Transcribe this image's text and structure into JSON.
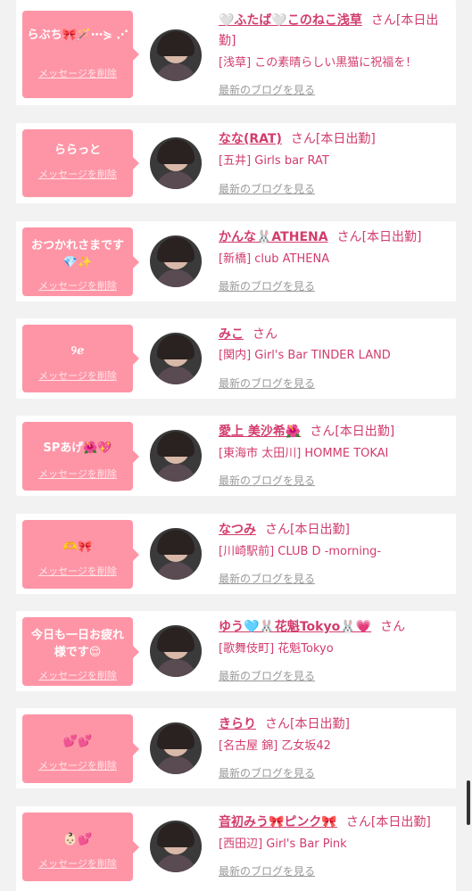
{
  "delete_label": "メッセージを削除",
  "blog_label": "最新のブログを見る",
  "san": "さん",
  "colors": {
    "bubble": "#fe95a6",
    "accent": "#d23c6c",
    "link_gray": "#9a9a9a",
    "background": "#f2f2f2"
  },
  "entries": [
    {
      "message": "らぶち🎀🪄⋯⋟ ⋰",
      "name": "🤍ふたば🤍このねこ浅草",
      "status": "[本日出勤]",
      "shop": "[浅草] この素晴らしい黒猫に祝福を！",
      "avatar_icon": "cat-ear-girl-avatar-icon"
    },
    {
      "message": "ららっと",
      "name": "なな(RAT)",
      "status": "[本日出勤]",
      "shop": "[五井] Girls bar RAT",
      "avatar_icon": "girl-avatar-icon"
    },
    {
      "message": "おつかれさまです💎✨",
      "name": "かんな🐰ATHENA",
      "status": "[本日出勤]",
      "shop": "[新橋] club ATHENA",
      "avatar_icon": "girl-avatar-icon"
    },
    {
      "message": "୨ℯ",
      "name": "みこ",
      "status": "",
      "shop": "[関内] Girl's Bar TINDER LAND",
      "avatar_icon": "girl-avatar-icon"
    },
    {
      "message": "SPあげ🌺💖",
      "name": "愛上 美沙希🌺",
      "status": "[本日出勤]",
      "shop": "[東海市 太田川] HOMME TOKAI",
      "avatar_icon": "girl-avatar-icon"
    },
    {
      "message": "🫶🎀",
      "name": "なつみ",
      "status": "[本日出勤]",
      "shop": "[川崎駅前] CLUB D -morning-",
      "avatar_icon": "standing-girl-avatar-icon"
    },
    {
      "message": "今日も一日お疲れ様です😌",
      "name": "ゆう🩵🐰花魁Tokyo🐰💗",
      "status": "",
      "shop": "[歌舞伎町] 花魁Tokyo",
      "avatar_icon": "girl-avatar-icon"
    },
    {
      "message": "💕💕",
      "name": "きらり",
      "status": "[本日出勤]",
      "shop": "[名古屋 錦] 乙女坂42",
      "avatar_icon": "girl-avatar-icon"
    },
    {
      "message": "👶🏻💕",
      "name": "音初みう🎀ピンク🎀",
      "status": "[本日出勤]",
      "shop": "[西田辺] Girl's Bar Pink",
      "avatar_icon": "two-girls-avatar-icon"
    }
  ]
}
